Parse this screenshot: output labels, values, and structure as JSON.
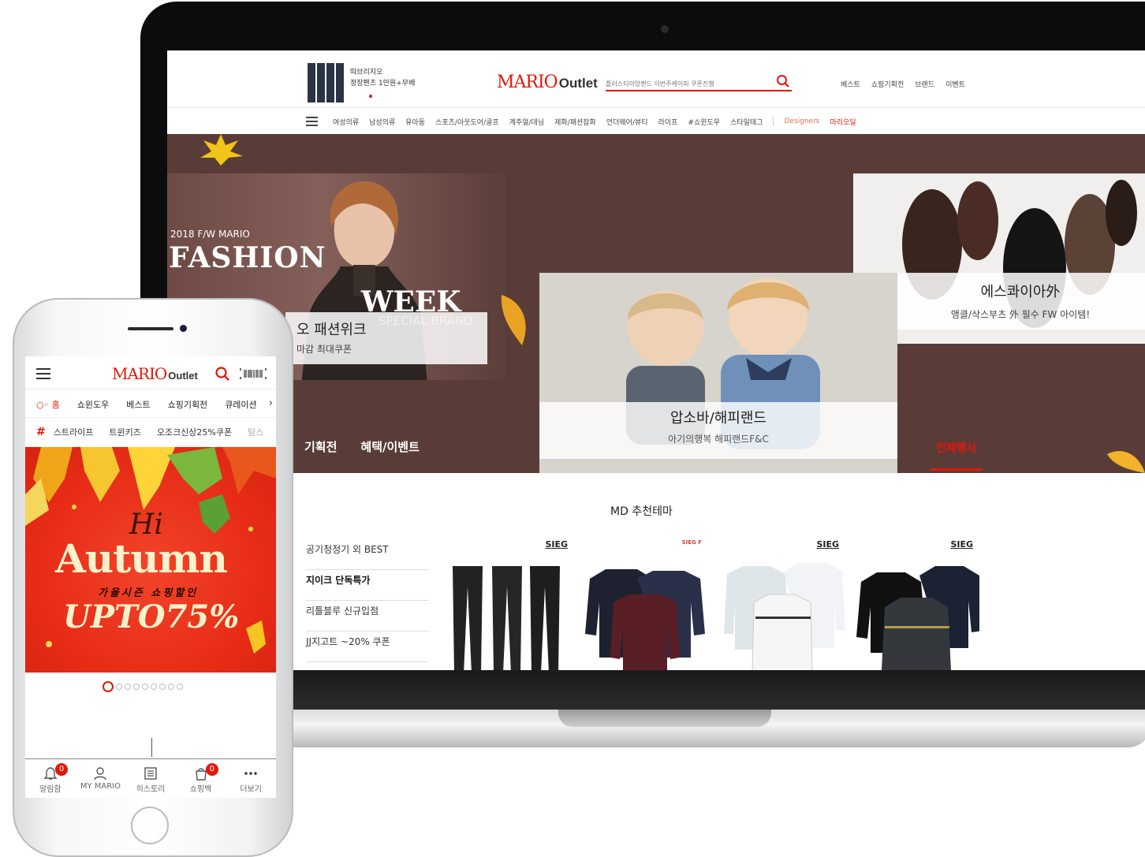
{
  "desktop": {
    "promo": {
      "line1": "따브리지오",
      "line2": "정장팬츠 1만원+무배"
    },
    "logo": {
      "mario": "MARIO",
      "outlet": "Outlet"
    },
    "search": {
      "placeholder": "플러스티아앙랜드 이번주케이피 쿠폰진행"
    },
    "top_links": [
      "베스트",
      "쇼핑기획전",
      "브랜드",
      "이벤트"
    ],
    "categories": [
      "여성의류",
      "남성의류",
      "유아동",
      "스포츠/아웃도어/골프",
      "계주얼/데님",
      "제화/패션잡화",
      "언더웨어/뷰티",
      "라이프",
      "#쇼윈도우",
      "스타일태그"
    ],
    "categories_extra": [
      "Designers",
      "마리오딜"
    ],
    "hero": {
      "fashion_year": "2018 F/W MARIO",
      "fashion_big1": "FASHION",
      "fashion_big2": "WEEK",
      "fashion_special": "SPECIAL BRAND",
      "fashion_title": "오 패션위크",
      "fashion_sub": "마감 최대쿠폰",
      "kids_title": "압소바/해피랜드",
      "kids_sub": "아기의행복 해피랜드F&C",
      "shoes_title": "에스콰이아外",
      "shoes_sub": "앵클/삭스부츠 外 필수 FW 아이템!",
      "tab1": "기획전",
      "tab2": "혜택/이벤트",
      "all": "전체행사"
    },
    "md": {
      "title": "MD 추천테마",
      "list": [
        "공기청정기 외 BEST",
        "지이크 단독특가",
        "리틀블루 신규입점",
        "JJ지고트 ~20% 쿠폰"
      ],
      "brands": [
        "SIEG",
        "SIEG F",
        "SIEG",
        "SIEG"
      ]
    }
  },
  "mobile": {
    "logo": {
      "mario": "MARIO",
      "outlet": "Outlet"
    },
    "tabs": [
      "홈",
      "쇼윈도우",
      "베스트",
      "쇼핑기획전",
      "큐레이션"
    ],
    "tags": [
      "스트라이프",
      "트윈키즈",
      "오조크신상25%쿠폰",
      "탐스"
    ],
    "banner": {
      "hi": "Hi",
      "title": "Autumn",
      "sub": "가을시즌 쇼핑할인",
      "upto": "UPTO75%"
    },
    "bottom_nav": [
      {
        "label": "알림함",
        "badge": "0",
        "icon": "bell-icon"
      },
      {
        "label": "MY MARIO",
        "icon": "person-icon"
      },
      {
        "label": "히스토리",
        "icon": "history-icon"
      },
      {
        "label": "쇼핑백",
        "badge": "0",
        "icon": "bag-icon"
      },
      {
        "label": "더보기",
        "icon": "more-icon"
      }
    ]
  },
  "colors": {
    "brand_red": "#e3170a",
    "hero_bg": "#593c38"
  }
}
